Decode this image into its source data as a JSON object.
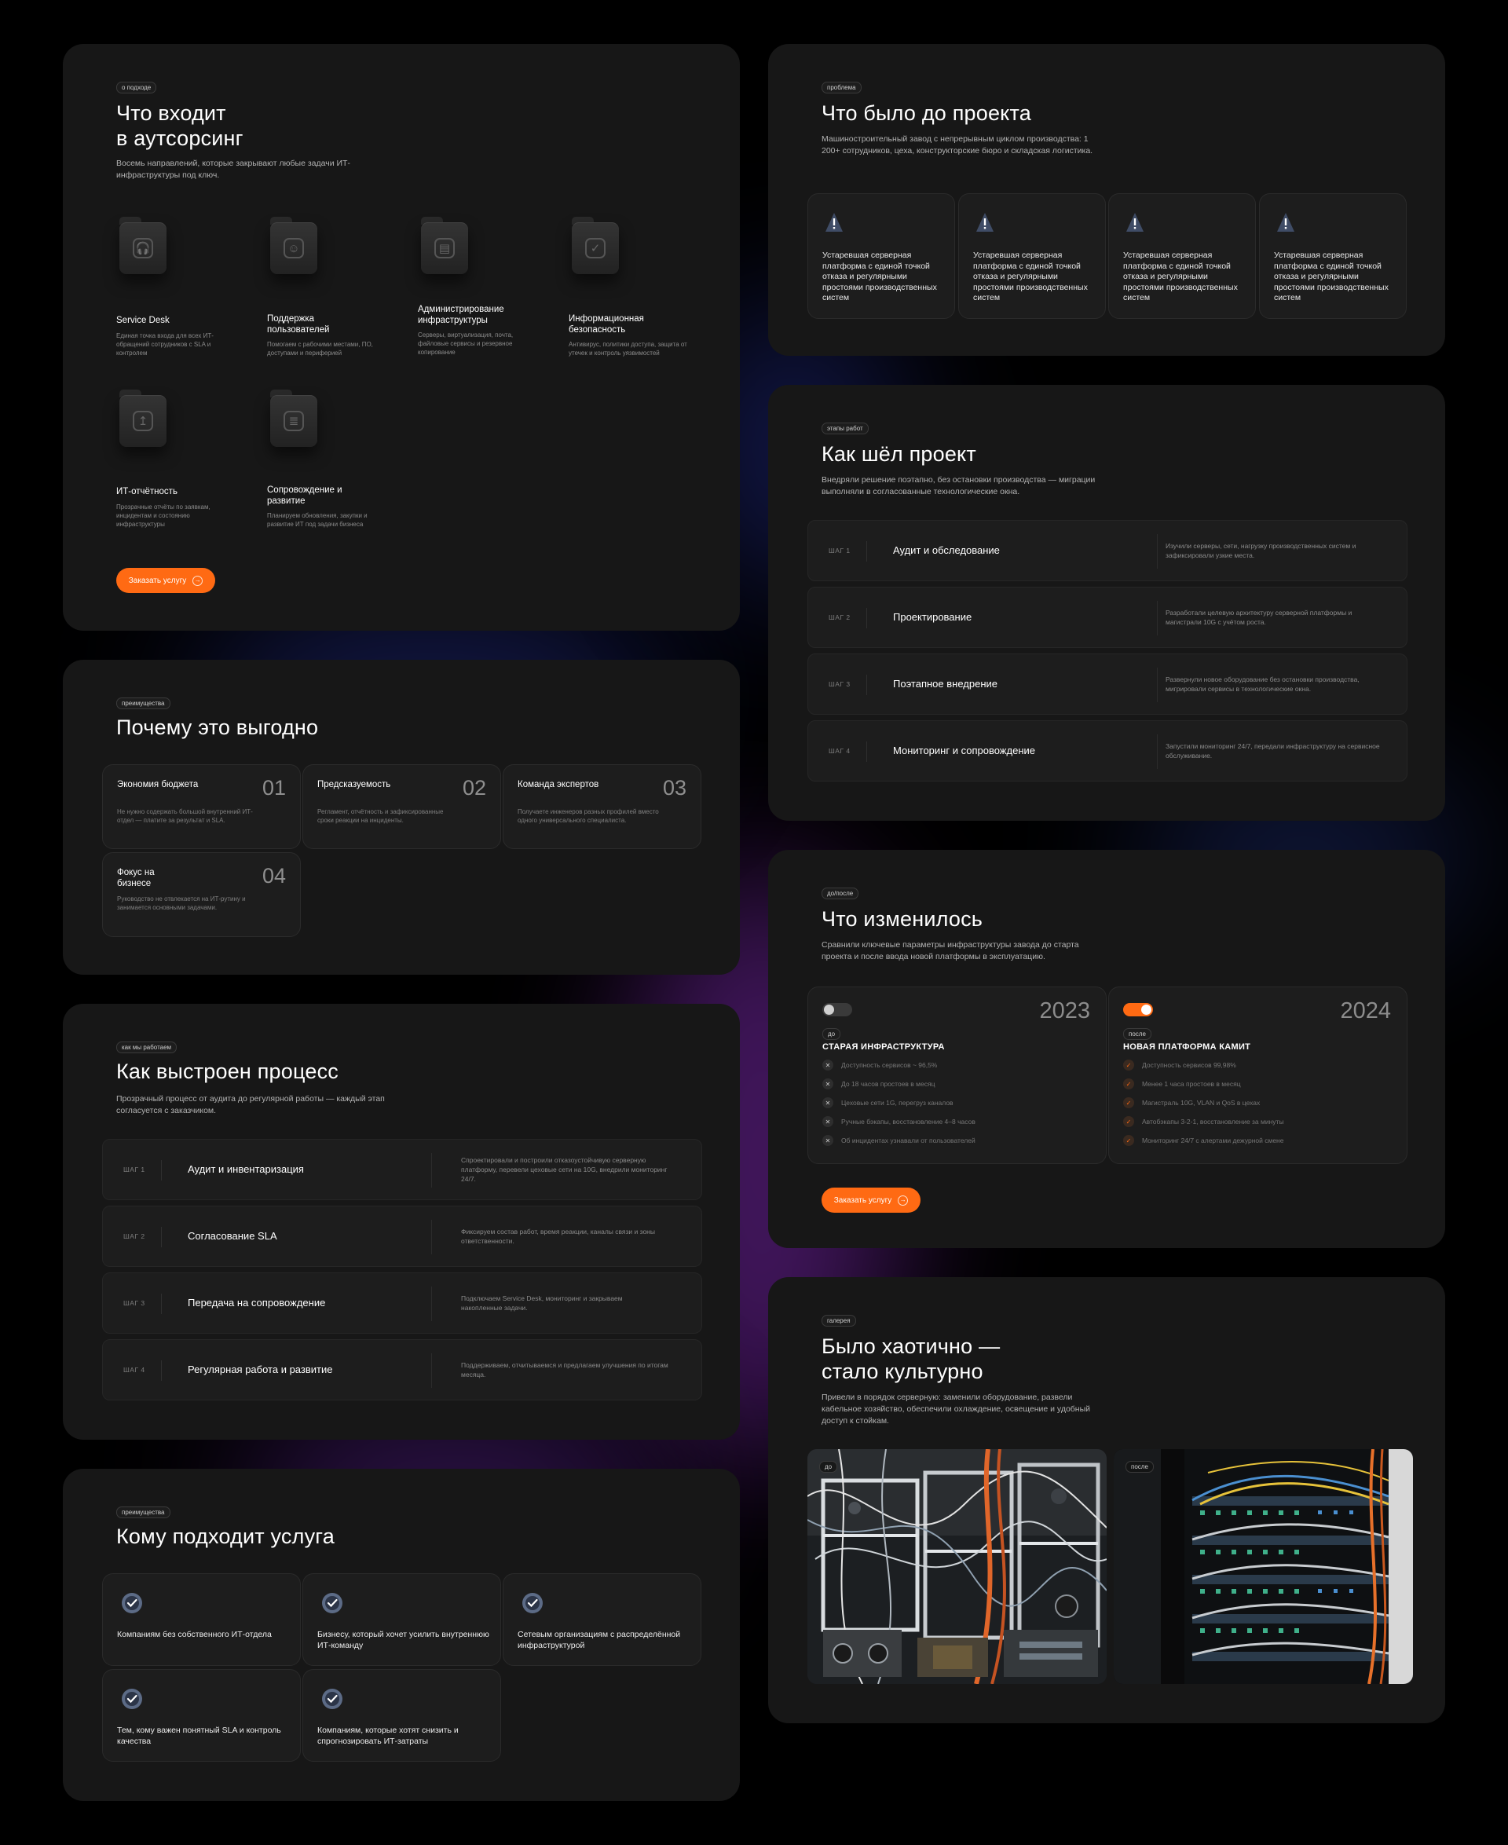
{
  "outsourcing": {
    "tag": "о подходе",
    "title": "Что входит\nв аутсорсинг",
    "subtitle": "Восемь направлений, которые закрывают любые задачи ИТ-инфраструктуры под ключ.",
    "services": [
      {
        "icon": "headphones-icon",
        "glyph": "🎧",
        "name": "Service Desk",
        "desc": "Единая точка входа для всех ИТ-обращений сотрудников с SLA и контролем"
      },
      {
        "icon": "user-icon",
        "glyph": "☺",
        "name": "Поддержка пользователей",
        "desc": "Помогаем с рабочими местами, ПО, доступами и периферией"
      },
      {
        "icon": "server-admin-icon",
        "glyph": "▤",
        "name": "Администрирование инфраструктуры",
        "desc": "Серверы, виртуализация, почта, файловые сервисы и резервное копирование"
      },
      {
        "icon": "shield-icon",
        "glyph": "✓",
        "name": "Информационная безопасность",
        "desc": "Антивирус, политики доступа, защита от утечек и контроль уязвимостей"
      },
      {
        "icon": "report-icon",
        "glyph": "↥",
        "name": "ИТ-отчётность",
        "desc": "Прозрачные отчёты по заявкам, инцидентам и состоянию инфраструктуры"
      },
      {
        "icon": "document-icon",
        "glyph": "≣",
        "name": "Сопровождение и развитие",
        "desc": "Планируем обновления, закупки и развитие ИТ под задачи бизнеса"
      }
    ],
    "cta": "Заказать услугу"
  },
  "advantages": {
    "tag": "преимущества",
    "title": "Почему это выгодно",
    "items": [
      {
        "title": "Экономия бюджета",
        "num": "01",
        "desc": "Не нужно содержать большой внутренний ИТ-отдел — платите за результат и SLA."
      },
      {
        "title": "Предсказуемость",
        "num": "02",
        "desc": "Регламент, отчётность и зафиксированные сроки реакции на инциденты."
      },
      {
        "title": "Команда экспертов",
        "num": "03",
        "desc": "Получаете инженеров разных профилей вместо одного универсального специалиста."
      },
      {
        "title": "Фокус на бизнесе",
        "num": "04",
        "desc": "Руководство не отвлекается на ИТ-рутину и занимается основными задачами."
      }
    ]
  },
  "process": {
    "tag": "как мы работаем",
    "title": "Как выстроен процесс",
    "subtitle": "Прозрачный процесс от аудита до регулярной работы — каждый этап согласуется с заказчиком.",
    "steps": [
      {
        "num": "ШАГ 1",
        "name": "Аудит и инвентаризация",
        "desc": "Спроектировали и построили отказоустойчивую серверную платформу, перевели цеховые сети на 10G, внедрили мониторинг 24/7."
      },
      {
        "num": "ШАГ 2",
        "name": "Согласование SLA",
        "desc": "Фиксируем состав работ, время реакции, каналы связи и зоны ответственности."
      },
      {
        "num": "ШАГ 3",
        "name": "Передача на сопровождение",
        "desc": "Подключаем Service Desk, мониторинг и закрываем накопленные задачи."
      },
      {
        "num": "ШАГ 4",
        "name": "Регулярная работа и развитие",
        "desc": "Поддерживаем, отчитываемся и предлагаем улучшения по итогам месяца."
      }
    ]
  },
  "audience": {
    "tag": "преимущества",
    "title": "Кому подходит услуга",
    "items": [
      "Компаниям без собственного ИТ-отдела",
      "Бизнесу, который хочет усилить внутреннюю ИТ-команду",
      "Сетевым организациям с распределённой инфраструктурой",
      "Тем, кому важен понятный SLA и контроль качества",
      "Компаниям, которые хотят снизить и спрогнозировать ИТ-затраты"
    ]
  },
  "problem": {
    "tag": "проблема",
    "title": "Что было до проекта",
    "subtitle": "Машиностроительный завод с непрерывным циклом производства: 1 200+ сотрудников, цеха, конструкторские бюро и складская логистика.",
    "items": [
      "Устаревшая серверная платформа с единой точкой отказа и регулярными простоями производственных систем",
      "Устаревшая серверная платформа с единой точкой отказа и регулярными простоями производственных систем",
      "Устаревшая серверная платформа с единой точкой отказа и регулярными простоями производственных систем",
      "Устаревшая серверная платформа с единой точкой отказа и регулярными простоями производственных систем"
    ]
  },
  "stages": {
    "tag": "этапы работ",
    "title": "Как шёл проект",
    "subtitle": "Внедряли решение поэтапно, без остановки производства — миграции выполняли в согласованные технологические окна.",
    "steps": [
      {
        "num": "ШАГ 1",
        "name": "Аудит и обследование",
        "desc": "Изучили серверы, сети, нагрузку производственных систем и зафиксировали узкие места."
      },
      {
        "num": "ШАГ 2",
        "name": "Проектирование",
        "desc": "Разработали целевую архитектуру серверной платформы и магистрали 10G с учётом роста."
      },
      {
        "num": "ШАГ 3",
        "name": "Поэтапное внедрение",
        "desc": "Развернули новое оборудование без остановки производства, мигрировали сервисы в технологические окна."
      },
      {
        "num": "ШАГ 4",
        "name": "Мониторинг и сопровождение",
        "desc": "Запустили мониторинг 24/7, передали инфраструктуру на сервисное обслуживание."
      }
    ]
  },
  "changes": {
    "tag": "до/после",
    "title": "Что изменилось",
    "subtitle": "Сравнили ключевые параметры инфраструктуры завода до старта проекта и после ввода новой платформы в эксплуатацию.",
    "before": {
      "year": "2023",
      "tag": "до",
      "head": "СТАРАЯ ИНФРАСТРУКТУРА",
      "items": [
        "Доступность сервисов ~ 96,5%",
        "До 18 часов простоев в месяц",
        "Цеховые сети 1G, перегруз каналов",
        "Ручные бэкапы, восстановление 4–8 часов",
        "Об инцидентах узнавали от пользователей"
      ]
    },
    "after": {
      "year": "2024",
      "tag": "после",
      "head": "НОВАЯ ПЛАТФОРМА КАМИТ",
      "items": [
        "Доступность сервисов 99,98%",
        "Менее 1 часа простоев в месяц",
        "Магистраль 10G, VLAN и QoS в цехах",
        "Автобэкапы 3-2-1, восстановление за минуты",
        "Мониторинг 24/7 с алертами дежурной смене"
      ]
    },
    "cta": "Заказать услугу",
    "colors": {
      "accent": "#ff6a13"
    }
  },
  "gallery": {
    "tag": "галерея",
    "title": "Было хаотично —\nстало культурно",
    "subtitle": "Привели в порядок серверную: заменили оборудование, развели кабельное хозяйство, обеспечили охлаждение, освещение и удобный доступ к стойкам.",
    "before_label": "до",
    "after_label": "после"
  }
}
